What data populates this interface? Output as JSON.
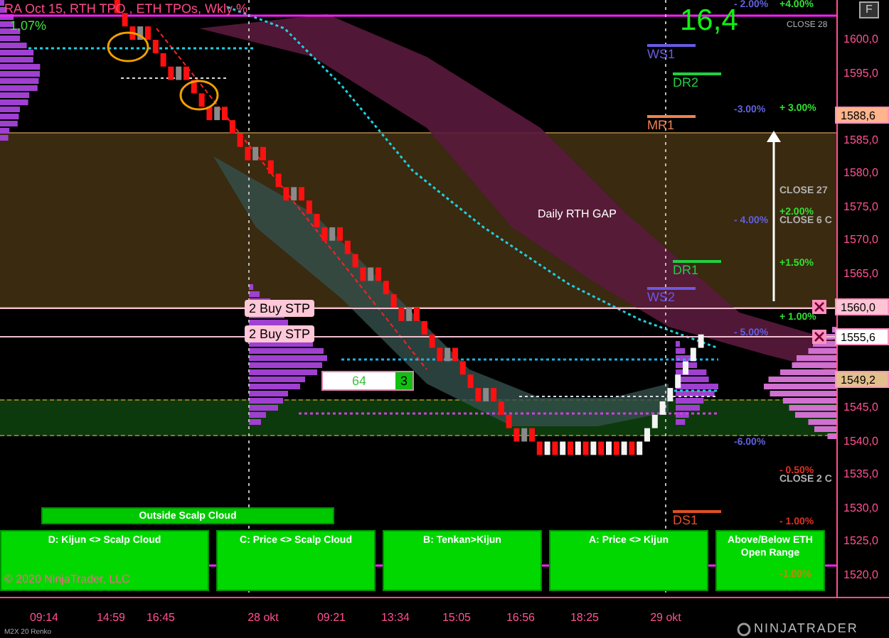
{
  "title": "RA Oct 15, RTH TPO , ETH TPOs, Wkly %",
  "change": "1,07%",
  "big_value": "16,4",
  "close_note": "CLOSE 28",
  "f_button": "F",
  "gap_label": "Daily RTH GAP",
  "levels": [
    {
      "label": "WS1",
      "color": "#6a5ae0"
    },
    {
      "label": "DR2",
      "color": "#20d040"
    },
    {
      "label": "MR1",
      "color": "#f08050"
    },
    {
      "label": "DR1",
      "color": "#20d040"
    },
    {
      "label": "WS2",
      "color": "#6a5ae0"
    },
    {
      "label": "DS1",
      "color": "#e05020"
    }
  ],
  "percent_labels": [
    {
      "text": "- 2.00%",
      "color": "#6060e0"
    },
    {
      "text": "+4.00%",
      "color": "#30e030"
    },
    {
      "text": "-3.00%",
      "color": "#6060e0"
    },
    {
      "text": "+ 3.00%",
      "color": "#30e030"
    },
    {
      "text": "CLOSE 27",
      "color": "#b0b0b0"
    },
    {
      "text": "+2.00%",
      "color": "#30e030"
    },
    {
      "text": "- 4.00%",
      "color": "#6060e0"
    },
    {
      "text": "CLOSE 6 C",
      "color": "#b0b0b0"
    },
    {
      "text": "+1.50%",
      "color": "#30e030"
    },
    {
      "text": "+ 1.00%",
      "color": "#30e030"
    },
    {
      "text": "- 5.00%",
      "color": "#6060e0"
    },
    {
      "text": "-6.00%",
      "color": "#6060e0"
    },
    {
      "text": "- 0.50%",
      "color": "#e03020"
    },
    {
      "text": "CLOSE 2 C",
      "color": "#b0b0b0"
    },
    {
      "text": "- 1.00%",
      "color": "#e03020"
    },
    {
      "text": "-1.00%",
      "color": "#d08010"
    }
  ],
  "orders": [
    {
      "text": "2 Buy STP"
    },
    {
      "text": "2 Buy STP"
    }
  ],
  "counter": {
    "value": "64",
    "count": "3"
  },
  "outside_button": "Outside Scalp Cloud",
  "signals": [
    "D: Kijun <> Scalp Cloud",
    "C: Price <> Scalp Cloud",
    "B: Tenkan>Kijun",
    "A: Price <> Kijun",
    "Above/Below ETH Open Range"
  ],
  "copyright": "© 2020 NinjaTrader, LLC",
  "price_axis": {
    "ticks": [
      "1600,0",
      "1595,0",
      "1585,0",
      "1580,0",
      "1575,0",
      "1570,0",
      "1565,0",
      "1545,0",
      "1540,0",
      "1535,0",
      "1530,0",
      "1525,0",
      "1520,0"
    ],
    "markers": [
      {
        "text": "1588,6",
        "color": "#ffb48c"
      },
      {
        "text": "1560,0",
        "color": "#ffc4d4"
      },
      {
        "text": "1555,6",
        "color": "#ffffff"
      },
      {
        "text": "1549,2",
        "color": "#e2c08e"
      }
    ]
  },
  "time_axis": [
    "09:14",
    "14:59",
    "16:45",
    "28 okt",
    "09:21",
    "13:34",
    "15:05",
    "16:56",
    "18:25",
    "29 okt"
  ],
  "instrument": "M2X 20 Renko",
  "brand": "NINJATRADER"
}
